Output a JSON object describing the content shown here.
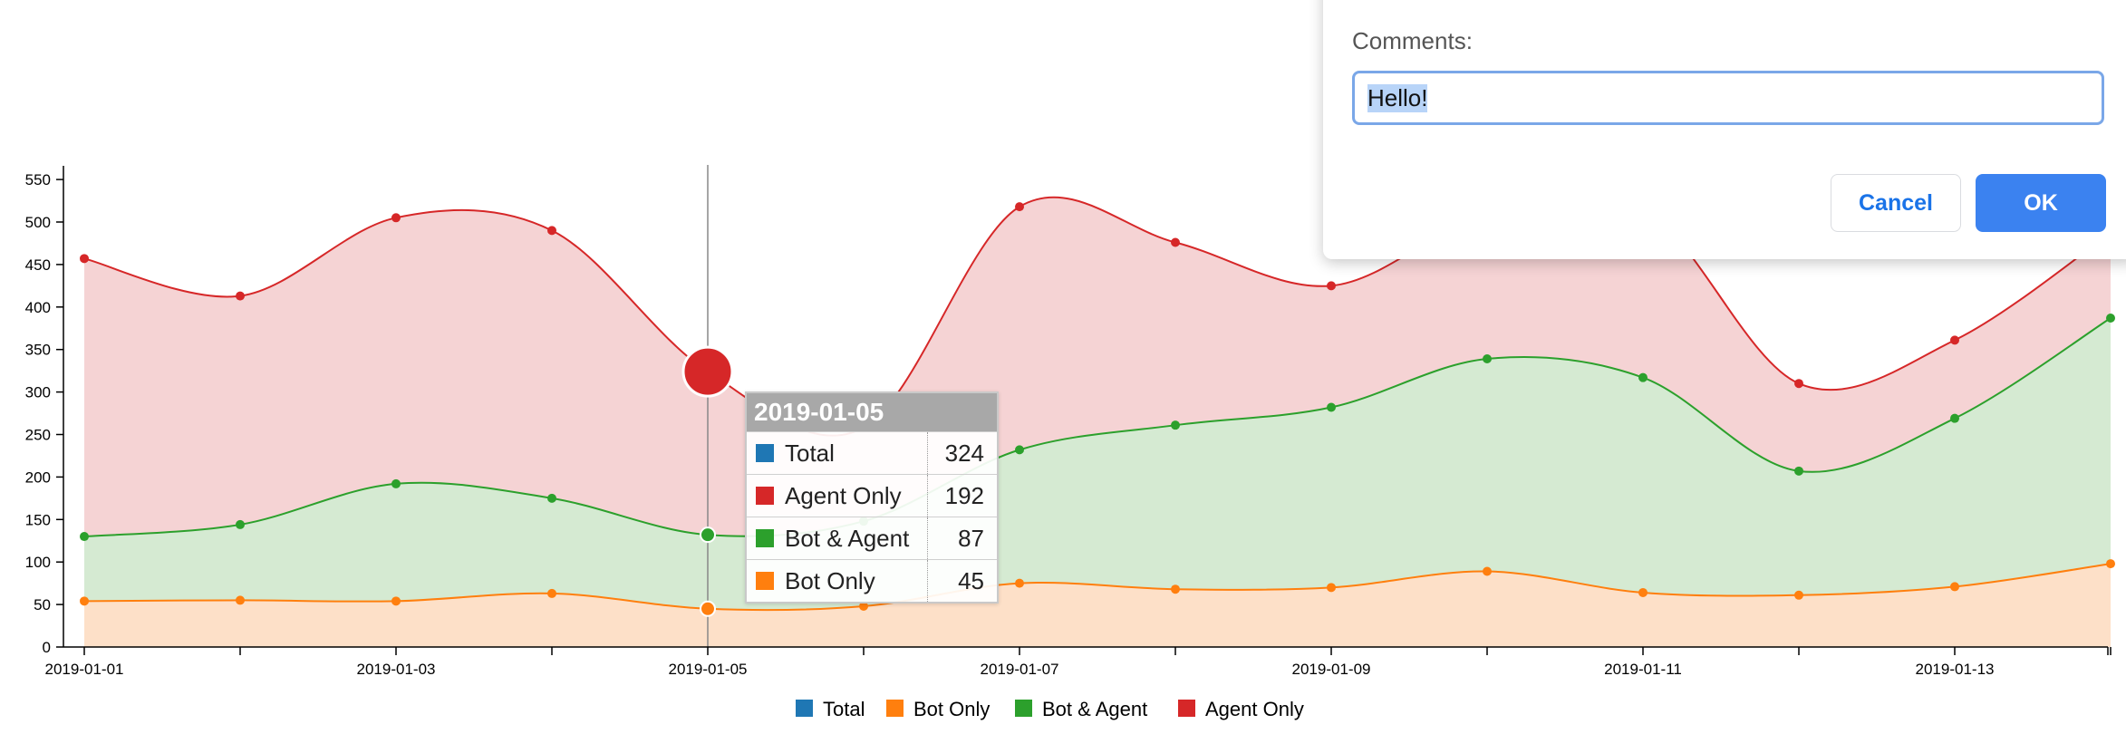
{
  "chart_data": {
    "type": "area",
    "x": [
      "2019-01-01",
      "2019-01-02",
      "2019-01-03",
      "2019-01-04",
      "2019-01-05",
      "2019-01-06",
      "2019-01-07",
      "2019-01-08",
      "2019-01-09",
      "2019-01-10",
      "2019-01-11",
      "2019-01-12",
      "2019-01-13",
      "2019-01-14"
    ],
    "x_tick_labels": [
      "2019-01-01",
      "2019-01-03",
      "2019-01-05",
      "2019-01-07",
      "2019-01-09",
      "2019-01-11",
      "2019-01-13"
    ],
    "y_ticks": [
      0,
      50,
      100,
      150,
      200,
      250,
      300,
      350,
      400,
      450,
      500,
      550
    ],
    "ylim": [
      0,
      560
    ],
    "stacked": true,
    "series": [
      {
        "name": "Bot Only",
        "color": "#ff7f0e",
        "fill": "#fde0c8",
        "values": [
          54,
          55,
          54,
          63,
          45,
          48,
          75,
          68,
          70,
          89,
          64,
          61,
          71,
          98
        ]
      },
      {
        "name": "Bot & Agent",
        "color": "#2ca02c",
        "fill": "#d5ead2",
        "values": [
          76,
          89,
          138,
          112,
          87,
          100,
          157,
          193,
          212,
          250,
          253,
          146,
          198,
          289
        ]
      },
      {
        "name": "Agent Only",
        "color": "#d62728",
        "fill": "#f5d3d4",
        "values": [
          327,
          269,
          313,
          315,
          192,
          110,
          286,
          215,
          143,
          170,
          200,
          103,
          92,
          100
        ]
      }
    ],
    "totals": [
      457,
      413,
      505,
      490,
      324,
      258,
      518,
      476,
      425,
      509,
      517,
      310,
      361,
      487
    ],
    "highlight_index": 4,
    "legend": [
      {
        "name": "Total",
        "color": "#1f77b4"
      },
      {
        "name": "Bot Only",
        "color": "#ff7f0e"
      },
      {
        "name": "Bot & Agent",
        "color": "#2ca02c"
      },
      {
        "name": "Agent Only",
        "color": "#d62728"
      }
    ],
    "legend_position": "bottom",
    "grid": false
  },
  "tooltip": {
    "title": "2019-01-05",
    "rows": [
      {
        "label": "Total",
        "value": "324",
        "color": "#1f77b4"
      },
      {
        "label": "Agent Only",
        "value": "192",
        "color": "#d62728"
      },
      {
        "label": "Bot & Agent",
        "value": "87",
        "color": "#2ca02c"
      },
      {
        "label": "Bot Only",
        "value": "45",
        "color": "#ff7f0e"
      }
    ]
  },
  "dialog": {
    "label": "Comments:",
    "input_value": "Hello!",
    "cancel_label": "Cancel",
    "ok_label": "OK"
  }
}
